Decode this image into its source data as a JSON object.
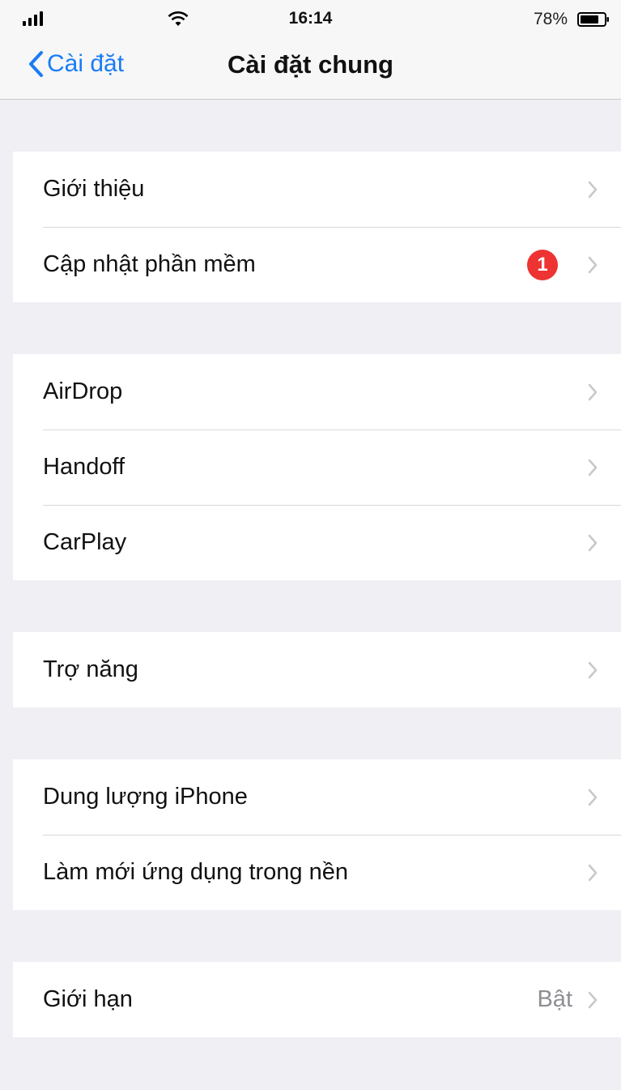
{
  "status_bar": {
    "carrier": "",
    "time": "16:14",
    "battery_percent": "78%"
  },
  "nav": {
    "back_label": "Cài đặt",
    "title": "Cài đặt chung"
  },
  "sections": [
    {
      "items": [
        {
          "label": "Giới thiệu",
          "value": "",
          "badge": ""
        },
        {
          "label": "Cập nhật phần mềm",
          "value": "",
          "badge": "1"
        }
      ]
    },
    {
      "items": [
        {
          "label": "AirDrop",
          "value": "",
          "badge": ""
        },
        {
          "label": "Handoff",
          "value": "",
          "badge": ""
        },
        {
          "label": "CarPlay",
          "value": "",
          "badge": ""
        }
      ]
    },
    {
      "items": [
        {
          "label": "Trợ năng",
          "value": "",
          "badge": ""
        }
      ]
    },
    {
      "items": [
        {
          "label": "Dung lượng iPhone",
          "value": "",
          "badge": ""
        },
        {
          "label": "Làm mới ứng dụng trong nền",
          "value": "",
          "badge": ""
        }
      ]
    },
    {
      "items": [
        {
          "label": "Giới hạn",
          "value": "Bật",
          "badge": ""
        }
      ]
    }
  ],
  "colors": {
    "accent": "#1a7cf5",
    "badge": "#ee3333",
    "background": "#efeff4"
  }
}
